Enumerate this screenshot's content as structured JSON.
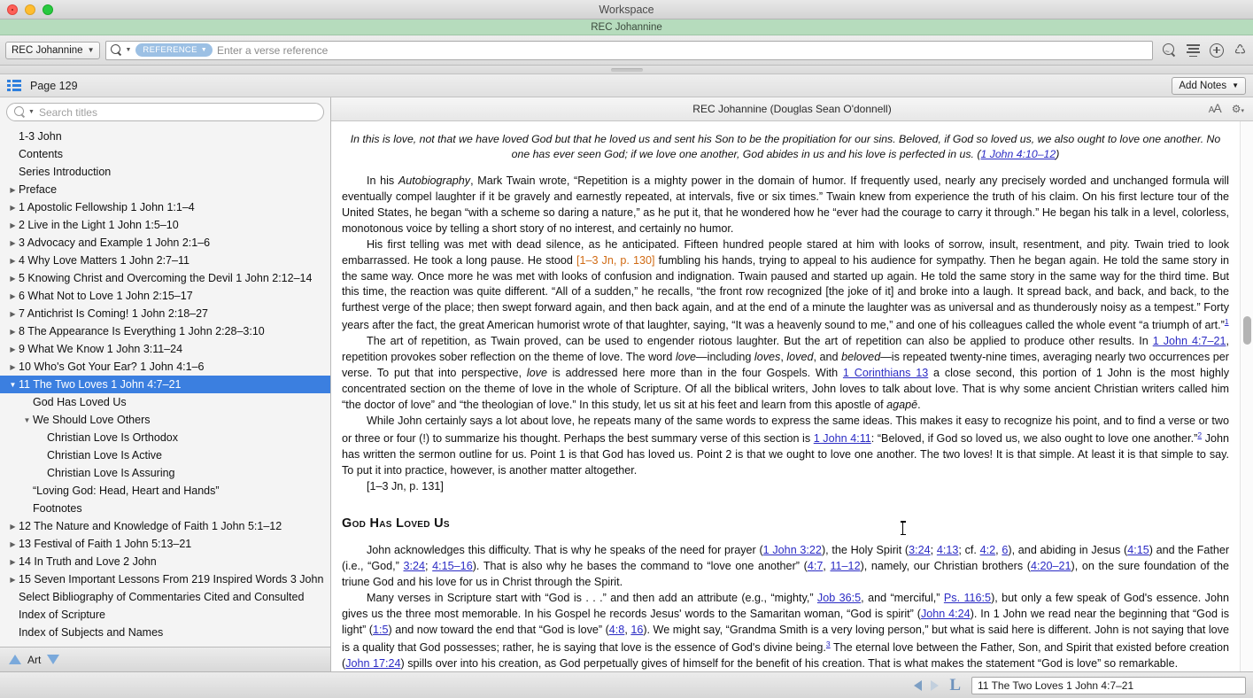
{
  "window": {
    "title": "Workspace",
    "subtitle": "REC Johannine"
  },
  "toolbar": {
    "library_label": "REC Johannine",
    "search_pill": "REFERENCE",
    "search_placeholder": "Enter a verse reference",
    "icons": [
      "search-wave-icon",
      "lines-icon",
      "plus-circle-icon",
      "recycle-icon"
    ]
  },
  "pagebar": {
    "page_label": "Page 129",
    "add_notes_label": "Add Notes"
  },
  "sidebar": {
    "search_placeholder": "Search titles",
    "footer_label": "Art",
    "items": [
      {
        "label": "1-3 John",
        "indent": 0,
        "twisty": "none"
      },
      {
        "label": "Contents",
        "indent": 0,
        "twisty": "none"
      },
      {
        "label": "Series Introduction",
        "indent": 0,
        "twisty": "none"
      },
      {
        "label": "Preface",
        "indent": 0,
        "twisty": "collapsed"
      },
      {
        "label": "1 Apostolic Fellowship 1 John 1:1–4",
        "indent": 0,
        "twisty": "collapsed"
      },
      {
        "label": "2 Live in the Light 1 John 1:5–10",
        "indent": 0,
        "twisty": "collapsed"
      },
      {
        "label": "3 Advocacy and Example 1 John 2:1–6",
        "indent": 0,
        "twisty": "collapsed"
      },
      {
        "label": "4 Why Love Matters 1 John 2:7–11",
        "indent": 0,
        "twisty": "collapsed"
      },
      {
        "label": "5 Knowing Christ and Overcoming the Devil 1 John 2:12–14",
        "indent": 0,
        "twisty": "collapsed"
      },
      {
        "label": "6 What Not to Love 1 John 2:15–17",
        "indent": 0,
        "twisty": "collapsed"
      },
      {
        "label": "7 Antichrist Is Coming! 1 John 2:18–27",
        "indent": 0,
        "twisty": "collapsed"
      },
      {
        "label": "8 The Appearance Is Everything 1 John 2:28–3:10",
        "indent": 0,
        "twisty": "collapsed"
      },
      {
        "label": "9 What We Know 1 John 3:11–24",
        "indent": 0,
        "twisty": "collapsed"
      },
      {
        "label": "10 Who's Got Your Ear? 1 John 4:1–6",
        "indent": 0,
        "twisty": "collapsed"
      },
      {
        "label": "11 The Two Loves 1 John 4:7–21",
        "indent": 0,
        "twisty": "expanded",
        "selected": true
      },
      {
        "label": "God Has Loved Us",
        "indent": 1,
        "twisty": "none"
      },
      {
        "label": "We Should Love Others",
        "indent": 1,
        "twisty": "expanded"
      },
      {
        "label": "Christian Love Is Orthodox",
        "indent": 2,
        "twisty": "none"
      },
      {
        "label": "Christian Love Is Active",
        "indent": 2,
        "twisty": "none"
      },
      {
        "label": "Christian Love Is Assuring",
        "indent": 2,
        "twisty": "none"
      },
      {
        "label": "“Loving God: Head, Heart and Hands”",
        "indent": 1,
        "twisty": "none"
      },
      {
        "label": "Footnotes",
        "indent": 1,
        "twisty": "none"
      },
      {
        "label": "12 The Nature and Knowledge of Faith 1 John 5:1–12",
        "indent": 0,
        "twisty": "collapsed"
      },
      {
        "label": "13 Festival of Faith 1 John 5:13–21",
        "indent": 0,
        "twisty": "collapsed"
      },
      {
        "label": "14 In Truth and Love 2 John",
        "indent": 0,
        "twisty": "collapsed"
      },
      {
        "label": "15 Seven Important Lessons From 219 Inspired Words 3 John",
        "indent": 0,
        "twisty": "collapsed"
      },
      {
        "label": "Select Bibliography of Commentaries Cited and Consulted",
        "indent": 0,
        "twisty": "none"
      },
      {
        "label": "Index of Scripture",
        "indent": 0,
        "twisty": "none"
      },
      {
        "label": "Index of Subjects and Names",
        "indent": 0,
        "twisty": "none"
      }
    ]
  },
  "content": {
    "header_title": "REC Johannine (Douglas Sean O'donnell)",
    "font_size_icon": "font-size-icon",
    "settings_icon": "gear-icon",
    "epigraph": {
      "text": "In this is love, not that we have loved God but that he loved us and sent his Son to be the propitiation for our sins. Beloved, if God so loved us, we also ought to love one another. No one has ever seen God; if we love one another, God abides in us and his love is perfected in us. (",
      "ref": "1 John 4:10–12",
      "tail": ")"
    },
    "para1": {
      "a": "In his ",
      "italic1": "Autobiography",
      "b": ", Mark Twain wrote, “Repetition is a mighty power in the domain of humor. If frequently used, nearly any precisely worded and unchanged formula will eventually compel laughter if it be gravely and earnestly repeated, at intervals, five or six times.” Twain knew from experience the truth of his claim. On his first lecture tour of the United States, he began “with a scheme so daring a nature,” as he put it, that he wondered how he “ever had the courage to carry it through.” He began his talk in a level, colorless, monotonous voice by telling a short story of no interest, and certainly no humor."
    },
    "para2": {
      "a": "His first telling was met with dead silence, as he anticipated. Fifteen hundred people stared at him with looks of sorrow, insult, resentment, and pity. Twain tried to look embarrassed. He took a long pause. He stood ",
      "pagemark": "[1–3 Jn, p. 130]",
      "b": " fumbling his hands, trying to appeal to his audience for sympathy. Then he began again. He told the same story in the same way. Once more he was met with looks of confusion and indignation. Twain paused and started up again. He told the same story in the same way for the third time. But this time, the reaction was quite different. “All of a sudden,” he recalls, “the front row recognized [the joke of it] and broke into a laugh. It spread back, and back, and back, to the furthest verge of the place; then swept forward again, and then back again, and at the end of a minute the laughter was as universal and as thunderously noisy as a tempest.” Forty years after the fact, the great American humorist wrote of that laughter, saying, “It was a heavenly sound to me,” and one of his colleagues called the whole event “a triumph of art.”",
      "footnote": "1"
    },
    "para3": {
      "a": "The art of repetition, as Twain proved, can be used to engender riotous laughter. But the art of repetition can also be applied to produce other results. In ",
      "ref1": "1 John 4:7–21",
      "b": ", repetition provokes sober reflection on the theme of love. The word ",
      "i1": "love",
      "c": "—including ",
      "i2": "loves",
      "d": ", ",
      "i3": "loved",
      "e": ", and ",
      "i4": "beloved",
      "f": "—is repeated twenty-nine times, averaging nearly two occurrences per verse. To put that into perspective, ",
      "i5": "love",
      "g": " is addressed here more than in the four Gospels. With ",
      "ref2": "1 Corinthians 13",
      "h": " a close second, this portion of 1 John is the most highly concentrated section on the theme of love in the whole of Scripture. Of all the biblical writers, John loves to talk about love. That is why some ancient Christian writers called him “the doctor of love” and “the theologian of love.” In this study, let us sit at his feet and learn from this apostle of ",
      "i6": "agapē",
      "i": "."
    },
    "para4": {
      "a": "While John certainly says a lot about love, he repeats many of the same words to express the same ideas. This makes it easy to recognize his point, and to find a verse or two or three or four (!) to summarize his thought. Perhaps the best summary verse of this section is ",
      "ref1": "1 John 4:11",
      "b": ": “Beloved, if God so loved us, we also ought to love one another.”",
      "footnote": "2",
      "c": " John has written the sermon outline for us. Point 1 is that God has loved us. Point 2 is that we ought to love one another. The two loves! It is that simple. At least it is that simple to say. To put it into practice, however, is another matter altogether."
    },
    "pagebreak": "[1–3 Jn, p. 131]",
    "section_heading": "God Has Loved Us",
    "para5": {
      "a": "John acknowledges this difficulty. That is why he speaks of the need for prayer (",
      "ref1": "1 John 3:22",
      "b": "), the Holy Spirit (",
      "ref2": "3:24",
      "c": "; ",
      "ref3": "4:13",
      "d": "; cf. ",
      "ref4": "4:2",
      "e": ", ",
      "ref5": "6",
      "f": "), and abiding in Jesus (",
      "ref6": "4:15",
      "g": ") and the Father (i.e., “God,” ",
      "ref7": "3:24",
      "h": "; ",
      "ref8": "4:15–16",
      "i": "). That is also why he bases the command to “love one another” (",
      "ref9": "4:7",
      "j": ", ",
      "ref10": "11–12",
      "k": "), namely, our Christian brothers (",
      "ref11": "4:20–21",
      "l": "), on the sure foundation of the triune God and his love for us in Christ through the Spirit."
    },
    "para6": {
      "a": "Many verses in Scripture start with “God is . . .” and then add an attribute (e.g., “mighty,” ",
      "ref1": "Job 36:5",
      "b": ", and “merciful,” ",
      "ref2": "Ps. 116:5",
      "c": "), but only a few speak of God's essence. John gives us the three most memorable. In his Gospel he records Jesus' words to the Samaritan woman, “God is spirit” (",
      "ref3": "John 4:24",
      "d": "). In 1 John we read near the beginning that “God is light” (",
      "ref4": "1:5",
      "e": ") and now toward the end that “God is love” (",
      "ref5": "4:8",
      "f": ", ",
      "ref6": "16",
      "g": "). We might say, “Grandma Smith is a very loving person,” but what is said here is different. John is not saying that love is a quality that God possesses; rather, he is saying that love is the essence of God's divine being.",
      "footnote": "3",
      "h": " The eternal love between the Father, Son, and Spirit that existed before creation (",
      "ref7": "John 17:24",
      "i": ") spills over into his creation, as God perpetually gives of himself for the benefit of his creation. That is what makes the statement “God is love” so remarkable."
    }
  },
  "bottombar": {
    "prev_icon": "nav-previous-icon",
    "next_icon": "nav-next-icon",
    "logos_icon": "logos-l-icon",
    "location_value": "11 The Two Loves 1 John 4:7–21"
  },
  "colors": {
    "selection_blue": "#3b7fe0",
    "link_blue": "#2b2bc4",
    "pagemark_orange": "#d06a13",
    "subtitle_green": "#b6dcbd"
  }
}
